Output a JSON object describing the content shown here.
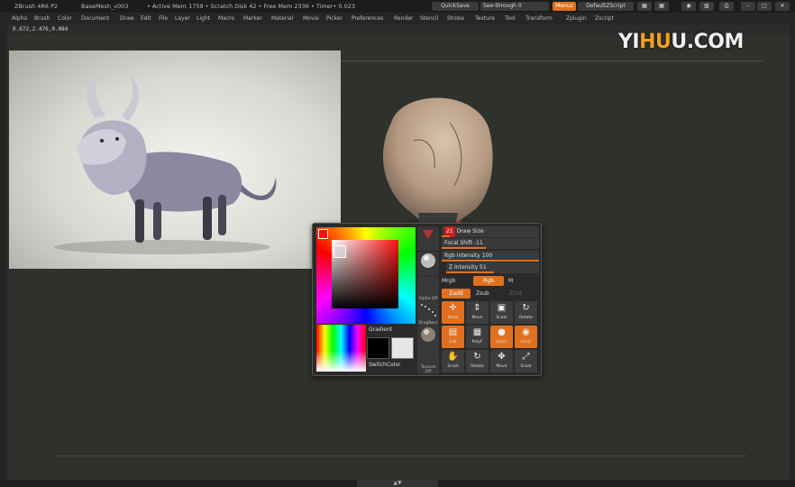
{
  "titlebar": {
    "app": "ZBrush 4R6 P2",
    "document": "BaseMesh_v003",
    "stats": "• Active Mem 1759 • Scratch Disk 42 • Free Mem 2336 • Timer• 0.023",
    "quicksave": "QuickSave",
    "see_through": "See-through",
    "see_through_value": "0",
    "menus_btn": "Menus",
    "default_script": "DefaultZScript"
  },
  "menubar": {
    "items": [
      "Alpha",
      "Brush",
      "Color",
      "Document",
      "Draw",
      "Edit",
      "File",
      "Layer",
      "Light",
      "Macro",
      "Marker",
      "Material",
      "Movie",
      "Picker",
      "Preferences",
      "Render",
      "Stencil",
      "Stroke",
      "Texture",
      "Tool",
      "Transform",
      "Zplugin",
      "Zscript"
    ]
  },
  "coords": "0.672,2.476,0.084",
  "watermark": {
    "part1": "YI",
    "part2": "H",
    "part3": "U",
    "part4": "U.COM"
  },
  "picker": {
    "gradient_label": "Gradient",
    "switchcolor_label": "SwitchColor",
    "brushes": [
      "Standard",
      "Alpha Off",
      "DragRect",
      "",
      "Texture Off"
    ],
    "draw_size": {
      "value": "21",
      "label": "Draw Size",
      "fraction": 0.08
    },
    "focal_shift": {
      "label": "Focal Shift -11",
      "fraction": 0.45
    },
    "rgb_intensity": {
      "label": "Rgb Intensity 100",
      "fraction": 1.0
    },
    "z_intensity": {
      "label": "Z Intensity 51",
      "fraction": 0.51
    },
    "mrgb": "Mrgb",
    "rgb": "Rgb",
    "m": "M",
    "zadd": "Zadd",
    "zsub": "Zsub",
    "zcut": "Zcut",
    "tools_row1": [
      {
        "glyph": "✛",
        "label": "Draw",
        "on": true
      },
      {
        "glyph": "⇕",
        "label": "Move",
        "on": false
      },
      {
        "glyph": "▣",
        "label": "Scale",
        "on": false
      },
      {
        "glyph": "↻",
        "label": "Rotate",
        "on": false
      }
    ],
    "tools_row2": [
      {
        "glyph": "▤",
        "label": "Edit",
        "on": true
      },
      {
        "glyph": "▦",
        "label": "PolyF",
        "on": false
      },
      {
        "glyph": "●",
        "label": "Quick",
        "on": true
      },
      {
        "glyph": "◉",
        "label": "Local",
        "on": true
      }
    ],
    "tools_row3": [
      {
        "glyph": "✋",
        "label": "Scroll",
        "on": false
      },
      {
        "glyph": "↻",
        "label": "Rotate",
        "on": false
      },
      {
        "glyph": "✥",
        "label": "Move",
        "on": false
      },
      {
        "glyph": "⤢",
        "label": "Scale",
        "on": false
      }
    ]
  },
  "bottom_handle": "▲▼"
}
